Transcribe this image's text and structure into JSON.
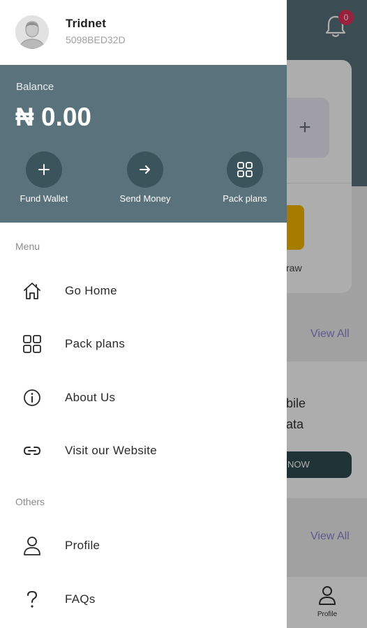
{
  "background": {
    "notification_count": "0",
    "draw_fragment": "raw",
    "view_all_1": "View All",
    "promo_line1": "bile",
    "promo_line2": "ata",
    "promo_button": "NOW",
    "view_all_2": "View All",
    "bottom_tab_profile": "Profile"
  },
  "drawer": {
    "user": {
      "name": "Tridnet",
      "id": "5098BED32D"
    },
    "balance": {
      "label": "Balance",
      "amount": "₦ 0.00",
      "actions": [
        {
          "label": "Fund Wallet",
          "icon": "plus-icon"
        },
        {
          "label": "Send Money",
          "icon": "arrow-right-icon"
        },
        {
          "label": "Pack plans",
          "icon": "grid-icon"
        }
      ]
    },
    "menu_section": "Menu",
    "menu_items": [
      {
        "label": "Go Home",
        "icon": "home-icon"
      },
      {
        "label": "Pack plans",
        "icon": "grid-icon"
      },
      {
        "label": "About Us",
        "icon": "info-icon"
      },
      {
        "label": "Visit our Website",
        "icon": "link-icon"
      }
    ],
    "others_section": "Others",
    "others_items": [
      {
        "label": "Profile",
        "icon": "user-icon"
      },
      {
        "label": "FAQs",
        "icon": "question-icon"
      }
    ]
  },
  "colors": {
    "header_teal": "#57707a",
    "balance_panel": "#5a727b",
    "action_circle": "#3b535a",
    "badge": "#e0335b",
    "accent_purple": "#8b85d6",
    "cta_dark": "#2f4a4f",
    "yellow": "#f5b700"
  }
}
